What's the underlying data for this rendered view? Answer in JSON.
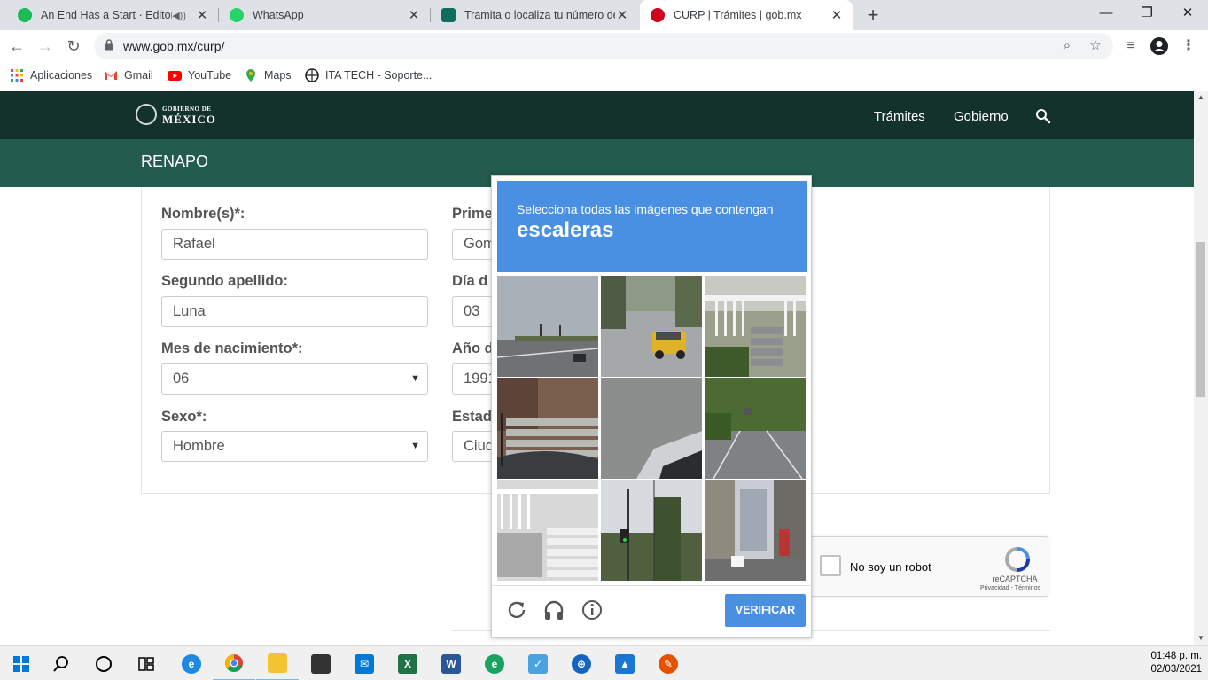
{
  "browser": {
    "tabs": [
      {
        "title": "An End Has a Start · Editors",
        "icon": "spotify-icon",
        "color": "#1db954"
      },
      {
        "title": "WhatsApp",
        "icon": "whatsapp-icon",
        "color": "#25d366"
      },
      {
        "title": "Tramita o localiza tu número de s",
        "icon": "gov-doc-icon",
        "color": "#0f6e5a"
      },
      {
        "title": "CURP | Trámites | gob.mx",
        "icon": "gobmx-icon",
        "color": "#d0021b"
      }
    ],
    "url": "www.gob.mx/curp/",
    "bookmarks": [
      {
        "label": "Aplicaciones",
        "icon": "apps-grid-icon"
      },
      {
        "label": "Gmail",
        "icon": "gmail-icon"
      },
      {
        "label": "YouTube",
        "icon": "youtube-icon"
      },
      {
        "label": "Maps",
        "icon": "maps-icon"
      },
      {
        "label": "ITA TECH - Soporte...",
        "icon": "ita-tech-icon"
      }
    ]
  },
  "site": {
    "logo_top": "GOBIERNO DE",
    "logo_bottom": "MÉXICO",
    "nav": [
      "Trámites",
      "Gobierno"
    ],
    "section_title": "RENAPO"
  },
  "form": {
    "fields": [
      {
        "label": "Nombre(s)*:",
        "value": "Rafael"
      },
      {
        "label": "Prime",
        "value": "Gom"
      },
      {
        "label": "Segundo apellido:",
        "value": "Luna"
      },
      {
        "label": "Día d",
        "value": "03"
      },
      {
        "label": "Mes de nacimiento*:",
        "value": "06"
      },
      {
        "label": "Año d",
        "value": "1991"
      },
      {
        "label": "Sexo*:",
        "value": "Hombre"
      },
      {
        "label": "Estad",
        "value": "Ciud"
      }
    ]
  },
  "recaptcha": {
    "checkbox_label": "No soy un robot",
    "brand": "reCAPTCHA",
    "links": "Privacidad - Términos"
  },
  "challenge": {
    "instruction": "Selecciona todas las imágenes que contengan",
    "keyword": "escaleras",
    "verify_label": "VERIFICAR",
    "tiles": [
      "highway-traffic-photo",
      "yellow-taxi-street-photo",
      "porch-stairs-photo",
      "building-stairs-photo",
      "road-surface-photo",
      "tree-lined-road-photo",
      "white-porch-stairs-photo",
      "traffic-light-trees-photo",
      "city-street-buildings-photo"
    ]
  },
  "taskbar": {
    "time": "01:48 p. m.",
    "date": "02/03/2021"
  }
}
